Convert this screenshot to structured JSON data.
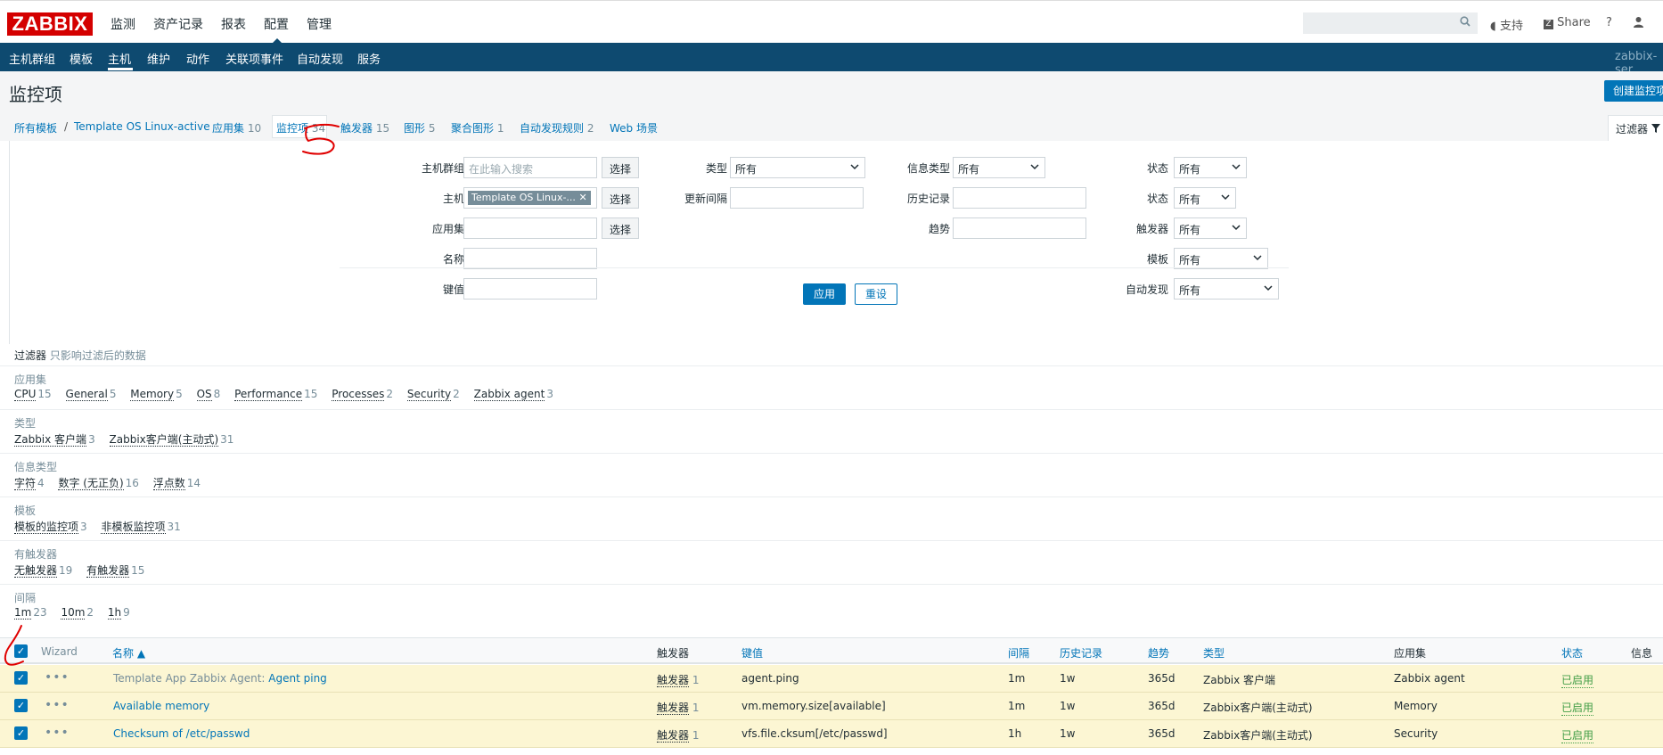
{
  "topbar": {
    "logo": "ZABBIX",
    "menu": [
      "监测",
      "资产记录",
      "报表",
      "配置",
      "管理"
    ],
    "support": "支持",
    "share": "Share",
    "help": "?",
    "user_icon": "user-icon"
  },
  "submenu": {
    "items": [
      "主机群组",
      "模板",
      "主机",
      "维护",
      "动作",
      "关联项事件",
      "自动发现",
      "服务"
    ],
    "active": "主机",
    "server": "zabbix-ser"
  },
  "header": {
    "title": "监控项",
    "create_button": "创建监控项"
  },
  "breadcrumbs": {
    "all_templates": "所有模板",
    "separator": "/",
    "template": "Template OS Linux-active",
    "tabs": [
      {
        "label": "应用集",
        "count": "10"
      },
      {
        "label": "监控项",
        "count": "34"
      },
      {
        "label": "触发器",
        "count": "15"
      },
      {
        "label": "图形",
        "count": "5"
      },
      {
        "label": "聚合图形",
        "count": "1"
      },
      {
        "label": "自动发现规则",
        "count": "2"
      },
      {
        "label": "Web 场景",
        "count": ""
      }
    ],
    "filter_tab": "过滤器"
  },
  "filter": {
    "col1": {
      "host_group_label": "主机群组",
      "host_group_placeholder": "在此输入搜索",
      "host_label": "主机",
      "host_chip": "Template OS Linux-...",
      "app_label": "应用集",
      "name_label": "名称",
      "key_label": "键值",
      "select_label": "选择"
    },
    "col2": {
      "type_label": "类型",
      "type_value": "所有",
      "interval_label": "更新间隔"
    },
    "col3": {
      "info_type_label": "信息类型",
      "info_type_value": "所有",
      "history_label": "历史记录",
      "trends_label": "趋势"
    },
    "col4": {
      "state_label": "状态",
      "state_value": "所有",
      "status_label": "状态",
      "status_value": "所有",
      "triggers_label": "触发器",
      "triggers_value": "所有",
      "template_label": "模板",
      "template_value": "所有",
      "discovery_label": "自动发现",
      "discovery_value": "所有"
    },
    "apply": "应用",
    "reset": "重设"
  },
  "subfilter": {
    "title": "过滤器",
    "note": "只影响过滤后的数据",
    "groups": [
      {
        "label": "应用集",
        "items": [
          {
            "name": "CPU",
            "count": "15"
          },
          {
            "name": "General",
            "count": "5"
          },
          {
            "name": "Memory",
            "count": "5"
          },
          {
            "name": "OS",
            "count": "8"
          },
          {
            "name": "Performance",
            "count": "15"
          },
          {
            "name": "Processes",
            "count": "2"
          },
          {
            "name": "Security",
            "count": "2"
          },
          {
            "name": "Zabbix agent",
            "count": "3"
          }
        ]
      },
      {
        "label": "类型",
        "items": [
          {
            "name": "Zabbix 客户端",
            "count": "3"
          },
          {
            "name": "Zabbix客户端(主动式)",
            "count": "31"
          }
        ]
      },
      {
        "label": "信息类型",
        "items": [
          {
            "name": "字符",
            "count": "4"
          },
          {
            "name": "数字 (无正负)",
            "count": "16"
          },
          {
            "name": "浮点数",
            "count": "14"
          }
        ]
      },
      {
        "label": "模板",
        "items": [
          {
            "name": "模板的监控项",
            "count": "3"
          },
          {
            "name": "非模板监控项",
            "count": "31"
          }
        ]
      },
      {
        "label": "有触发器",
        "items": [
          {
            "name": "无触发器",
            "count": "19"
          },
          {
            "name": "有触发器",
            "count": "15"
          }
        ]
      },
      {
        "label": "间隔",
        "items": [
          {
            "name": "1m",
            "count": "23"
          },
          {
            "name": "10m",
            "count": "2"
          },
          {
            "name": "1h",
            "count": "9"
          }
        ]
      }
    ]
  },
  "table": {
    "headers": {
      "wizard": "Wizard",
      "name": "名称 ▲",
      "triggers": "触发器",
      "key": "键值",
      "interval": "间隔",
      "history": "历史记录",
      "trends": "趋势",
      "type": "类型",
      "application": "应用集",
      "status": "状态",
      "info": "信息"
    },
    "rows": [
      {
        "template": "Template App Zabbix Agent:",
        "name": "Agent ping",
        "triggers_label": "触发器",
        "triggers_count": "1",
        "key": "agent.ping",
        "interval": "1m",
        "history": "1w",
        "trends": "365d",
        "type": "Zabbix 客户端",
        "application": "Zabbix agent",
        "status": "已启用"
      },
      {
        "template": "",
        "name": "Available memory",
        "triggers_label": "触发器",
        "triggers_count": "1",
        "key": "vm.memory.size[available]",
        "interval": "1m",
        "history": "1w",
        "trends": "365d",
        "type": "Zabbix客户端(主动式)",
        "application": "Memory",
        "status": "已启用"
      },
      {
        "template": "",
        "name": "Checksum of /etc/passwd",
        "triggers_label": "触发器",
        "triggers_count": "1",
        "key": "vfs.file.cksum[/etc/passwd]",
        "interval": "1h",
        "history": "1w",
        "trends": "365d",
        "type": "Zabbix客户端(主动式)",
        "application": "Security",
        "status": "已启用"
      }
    ]
  },
  "colors": {
    "brand": "#d40000",
    "nav": "#0e4a70",
    "link": "#0275b8",
    "row_highlight": "#fcf6d3",
    "enabled": "#429e47",
    "annotation": "#e00000"
  }
}
